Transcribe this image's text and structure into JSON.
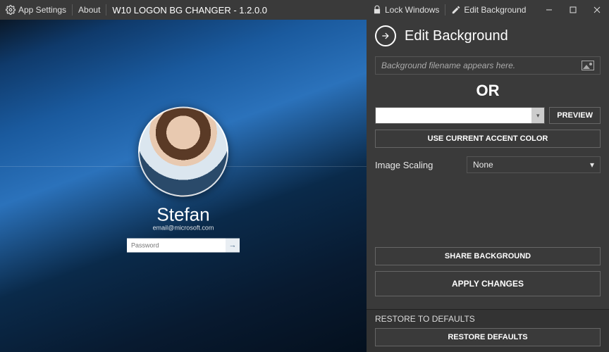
{
  "titlebar": {
    "app_settings": "App Settings",
    "about": "About",
    "title": "W10 LOGON BG CHANGER - 1.2.0.0",
    "lock_windows": "Lock Windows",
    "edit_background": "Edit Background"
  },
  "preview": {
    "username": "Stefan",
    "email": "email@microsoft.com",
    "password_placeholder": "Password"
  },
  "panel": {
    "title": "Edit Background",
    "file_placeholder": "Background filename appears here.",
    "or": "OR",
    "preview_btn": "PREVIEW",
    "use_accent": "USE CURRENT ACCENT COLOR",
    "scaling_label": "Image Scaling",
    "scaling_value": "None",
    "share": "SHARE BACKGROUND",
    "apply": "APPLY CHANGES",
    "restore_title": "RESTORE TO DEFAULTS",
    "restore_btn": "RESTORE DEFAULTS"
  }
}
